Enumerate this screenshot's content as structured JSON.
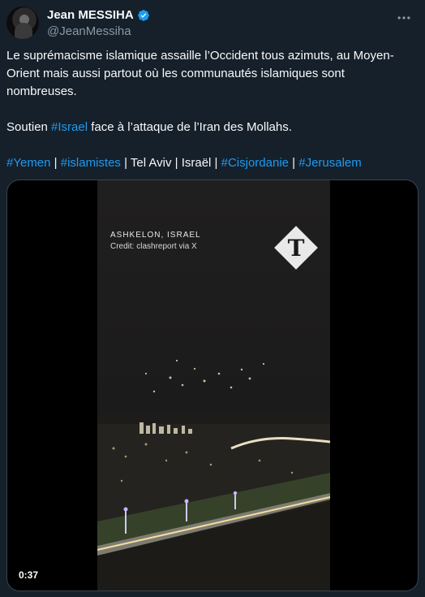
{
  "author": {
    "display_name": "Jean MESSIHA",
    "handle": "@JeanMessiha",
    "verified_icon": "verified-badge-icon",
    "more_icon": "more-options-icon"
  },
  "tweet": {
    "line1": "Le suprémacisme islamique assaille l’Occident tous azimuts, au Moyen-Orient mais aussi partout où les communautés islamiques sont nombreuses.",
    "p2_prefix": "Soutien ",
    "p2_tag": "#Israel",
    "p2_suffix": " face à l’attaque de l’Iran des Mollahs.",
    "tags": {
      "t1": "#Yemen",
      "sep1": " | ",
      "t2": "#islamistes",
      "mid": " | Tel Aviv | Israël | ",
      "t3": "#Cisjordanie",
      "sep2": " | ",
      "t4": "#Jerusalem"
    }
  },
  "media": {
    "location": "ASHKELON, ISRAEL",
    "credit": "Credit: clashreport via X",
    "logo_letter": "T",
    "duration": "0:37"
  },
  "colors": {
    "background": "#15202b",
    "link": "#1d9bf0",
    "secondary_text": "#8b98a5",
    "verified": "#1d9bf0"
  }
}
